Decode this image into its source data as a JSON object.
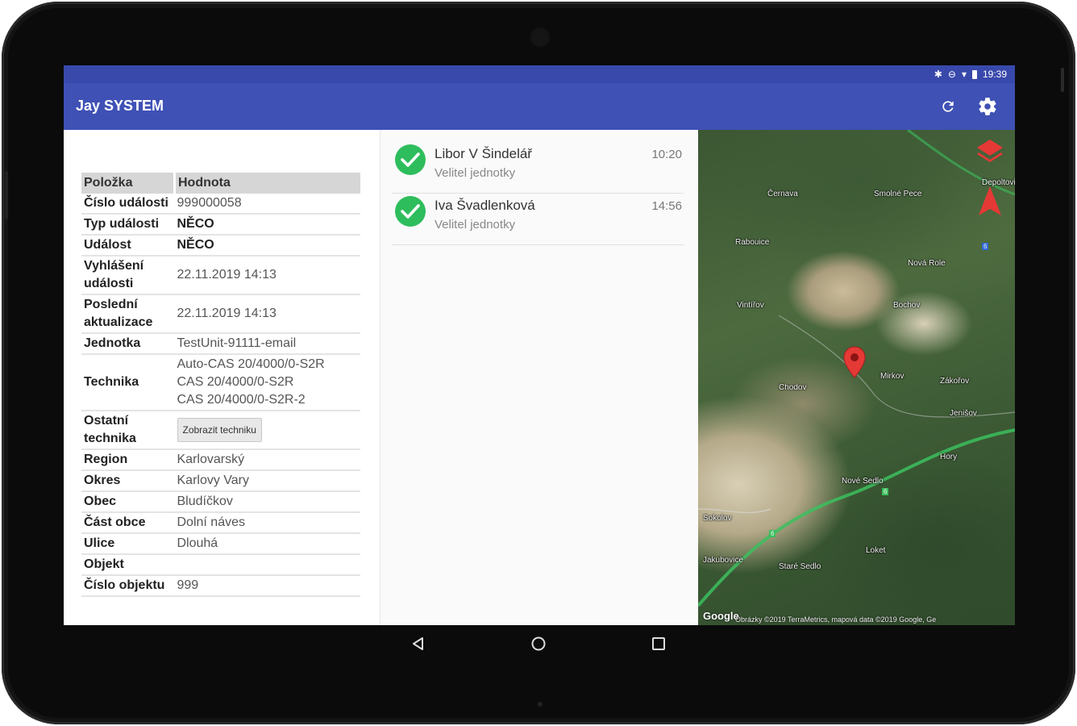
{
  "statusbar": {
    "time": "19:39"
  },
  "appbar": {
    "title": "Jay SYSTEM",
    "actions": [
      "refresh-icon",
      "settings-icon"
    ]
  },
  "details": {
    "header": {
      "key": "Položka",
      "value": "Hodnota"
    },
    "rows": [
      {
        "key": "Číslo události",
        "value": "999000058"
      },
      {
        "key": "Typ události",
        "value": "NĚCO"
      },
      {
        "key": "Událost",
        "value": "NĚCO"
      },
      {
        "key": "Vyhlášení události",
        "value": "22.11.2019 14:13"
      },
      {
        "key": "Poslední aktualizace",
        "value": "22.11.2019 14:13"
      },
      {
        "key": "Jednotka",
        "value": "TestUnit-91111-email"
      },
      {
        "key": "Technika",
        "value_lines": [
          "Auto-CAS 20/4000/0-S2R",
          "CAS 20/4000/0-S2R",
          "CAS 20/4000/0-S2R-2"
        ]
      },
      {
        "key": "Ostatní technika",
        "button": "Zobrazit techniku"
      },
      {
        "key": "Region",
        "value": "Karlovarský"
      },
      {
        "key": "Okres",
        "value": "Karlovy Vary"
      },
      {
        "key": "Obec",
        "value": "Bludíčkov"
      },
      {
        "key": "Část obce",
        "value": "Dolní náves"
      },
      {
        "key": "Ulice",
        "value": "Dlouhá"
      },
      {
        "key": "Objekt",
        "value": ""
      },
      {
        "key": "Číslo objektu",
        "value": "999"
      }
    ]
  },
  "responders": [
    {
      "name": "Libor V Šindelář",
      "role": "Velitel jednotky",
      "time": "10:20",
      "status": "confirmed"
    },
    {
      "name": "Iva Švadlenková",
      "role": "Velitel jednotky",
      "time": "14:56",
      "status": "confirmed"
    }
  ],
  "map": {
    "labels": [
      "Černava",
      "Smolné Pece",
      "Depoltovice",
      "Rabouice",
      "Nová Role",
      "Vintířov",
      "Bochov",
      "Mirkov",
      "Zákořov",
      "Jenišov",
      "Hory",
      "Nové Sedlo",
      "Loket",
      "Staré Sedlo",
      "Sokolov",
      "Chodov",
      "Jakubovice"
    ],
    "road_numbers": [
      "6",
      "6",
      "6"
    ],
    "google": "Google",
    "attribution": "Obrázky ©2019 TerraMetrics, mapová data ©2019 Google, Ge",
    "controls": [
      "layers-icon",
      "north-arrow-icon"
    ],
    "marker": "location-pin-icon",
    "colors": {
      "road": "#3cbf5e",
      "pin": "#e53935",
      "controls": "#e53935"
    }
  },
  "navbar": {
    "buttons": [
      "back-icon",
      "home-icon",
      "recents-icon"
    ]
  },
  "colors": {
    "statusbar": "#3949ab",
    "appbar": "#3f51b5",
    "check": "#2ebd5c"
  }
}
